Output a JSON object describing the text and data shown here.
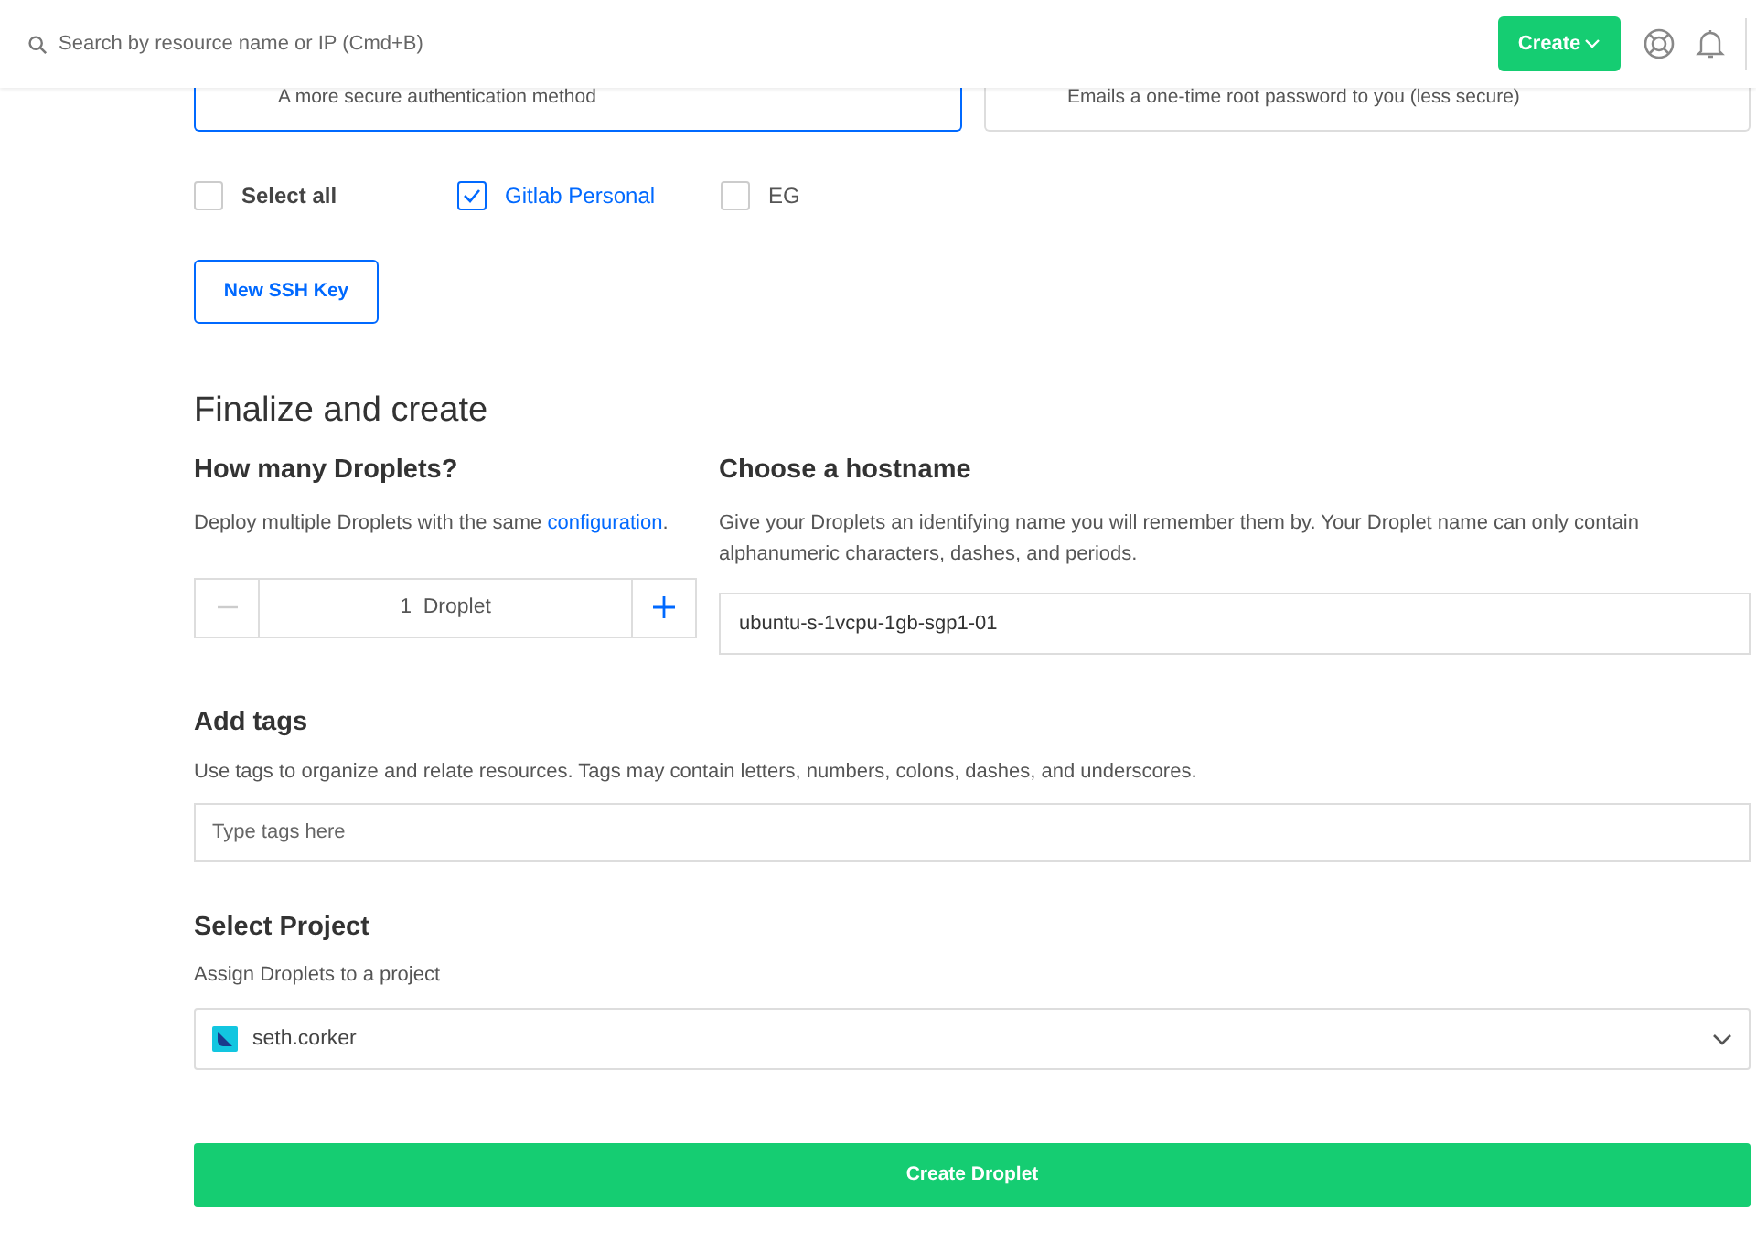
{
  "header": {
    "search": {
      "placeholder": "Search by resource name or IP (Cmd+B)"
    },
    "create_button": "Create"
  },
  "auth_options": [
    {
      "description": "A more secure authentication method",
      "selected": true
    },
    {
      "description": "Emails a one-time root password to you (less secure)",
      "selected": false
    }
  ],
  "ssh_keys": [
    {
      "label": "Select all",
      "checked": false,
      "kind": "all"
    },
    {
      "label": "Gitlab Personal",
      "checked": true,
      "kind": "key"
    },
    {
      "label": "EG",
      "checked": false,
      "kind": "key"
    }
  ],
  "new_ssh_key_button": "New SSH Key",
  "section_title": "Finalize and create",
  "droplet_count": {
    "title": "How many Droplets?",
    "description_before": "Deploy multiple Droplets with the same ",
    "link": "configuration",
    "description_after": ".",
    "value": "1  Droplet"
  },
  "hostname": {
    "title": "Choose a hostname",
    "description": "Give your Droplets an identifying name you will remember them by. Your Droplet name can only contain alphanumeric characters, dashes, and periods.",
    "value": "ubuntu-s-1vcpu-1gb-sgp1-01"
  },
  "tags": {
    "title": "Add tags",
    "description": "Use tags to organize and relate resources. Tags may contain letters, numbers, colons, dashes, and underscores.",
    "placeholder": "Type tags here"
  },
  "project": {
    "title": "Select Project",
    "description": "Assign Droplets to a project",
    "value": "seth.corker"
  },
  "submit_button": "Create Droplet"
}
